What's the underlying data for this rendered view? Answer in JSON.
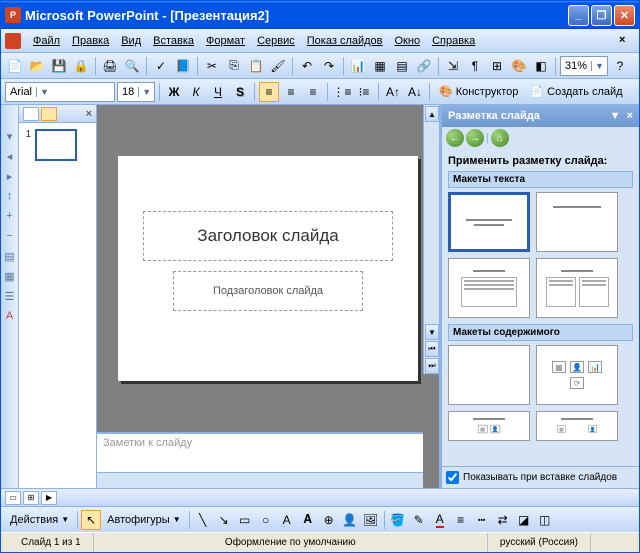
{
  "title": {
    "app": "Microsoft PowerPoint",
    "doc": "[Презентация2]"
  },
  "menu": {
    "file": "Файл",
    "edit": "Правка",
    "view": "Вид",
    "insert": "Вставка",
    "format": "Формат",
    "tools": "Сервис",
    "slideshow": "Показ слайдов",
    "window": "Окно",
    "help": "Справка"
  },
  "toolbar1": {
    "zoom": "31%"
  },
  "toolbar2": {
    "font": "Arial",
    "size": "18",
    "designer": "Конструктор",
    "newslide": "Создать слайд"
  },
  "outline": {
    "slide1_num": "1"
  },
  "slide": {
    "title_ph": "Заголовок слайда",
    "subtitle_ph": "Подзаголовок слайда"
  },
  "notes": {
    "placeholder": "Заметки к слайду"
  },
  "taskpane": {
    "title": "Разметка слайда",
    "apply_label": "Применить разметку слайда:",
    "group_text": "Макеты текста",
    "group_content": "Макеты содержимого",
    "show_on_insert": "Показывать при вставке слайдов"
  },
  "draw": {
    "actions": "Действия",
    "autoshapes": "Автофигуры"
  },
  "status": {
    "slide": "Слайд 1 из 1",
    "design": "Оформление по умолчанию",
    "lang": "русский (Россия)"
  }
}
